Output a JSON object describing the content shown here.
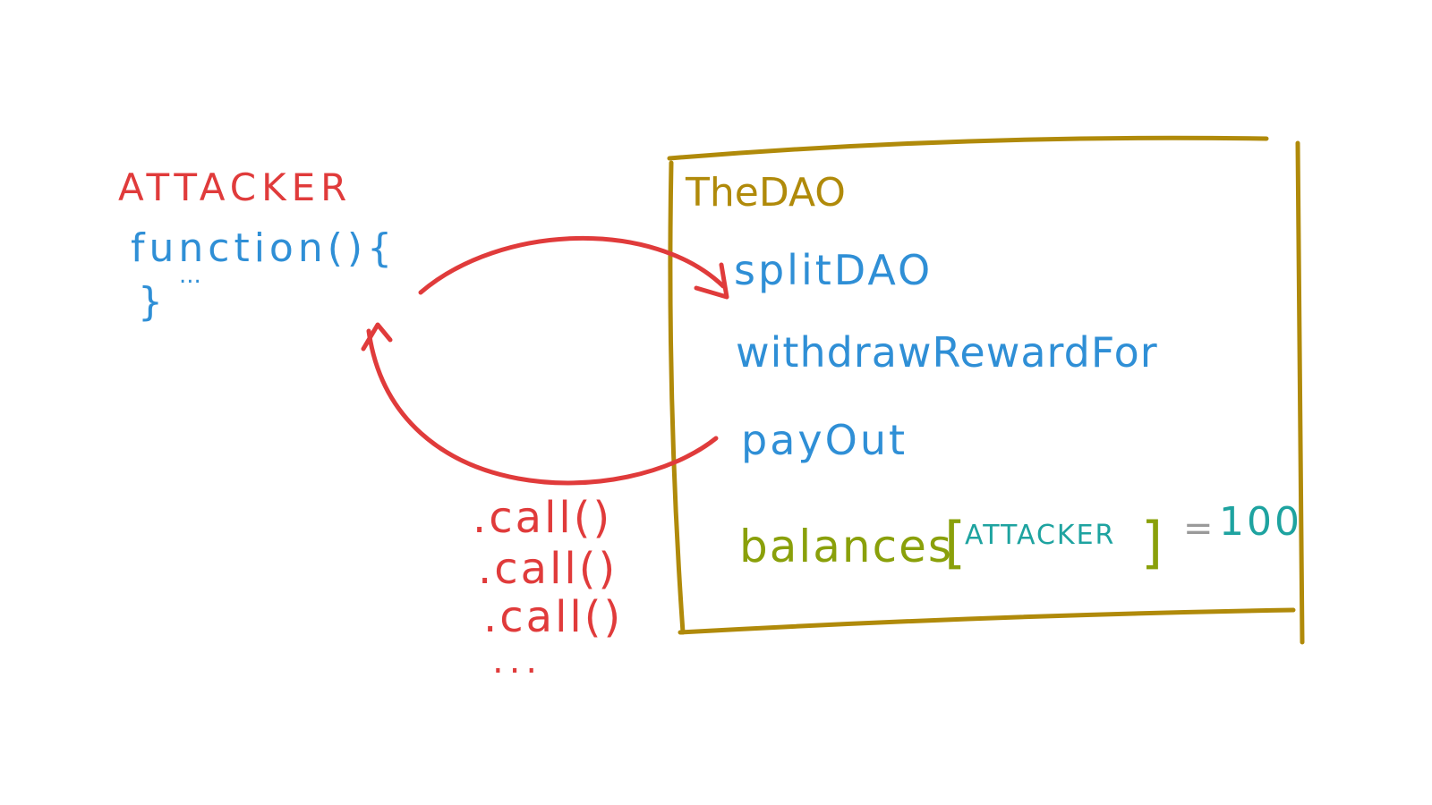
{
  "colors": {
    "attacker": "#e03b3b",
    "code": "#2f8fd6",
    "dao_box": "#b08a0a",
    "balances": "#8aa00a",
    "value": "#1ea3a0"
  },
  "attacker": {
    "title": "ATTACKER",
    "code_open": "function(){",
    "code_dots": "...",
    "code_close": "}"
  },
  "dao": {
    "title": "TheDAO",
    "functions": [
      "splitDAO",
      "withdrawRewardFor",
      "payOut"
    ],
    "balances_label": "balances",
    "bracket_open": "[",
    "balances_key": "ATTACKER",
    "bracket_close": "]",
    "equals": "=",
    "balances_value": "100"
  },
  "calls": {
    "items": [
      ".call()",
      ".call()",
      ".call()"
    ],
    "more": "..."
  }
}
